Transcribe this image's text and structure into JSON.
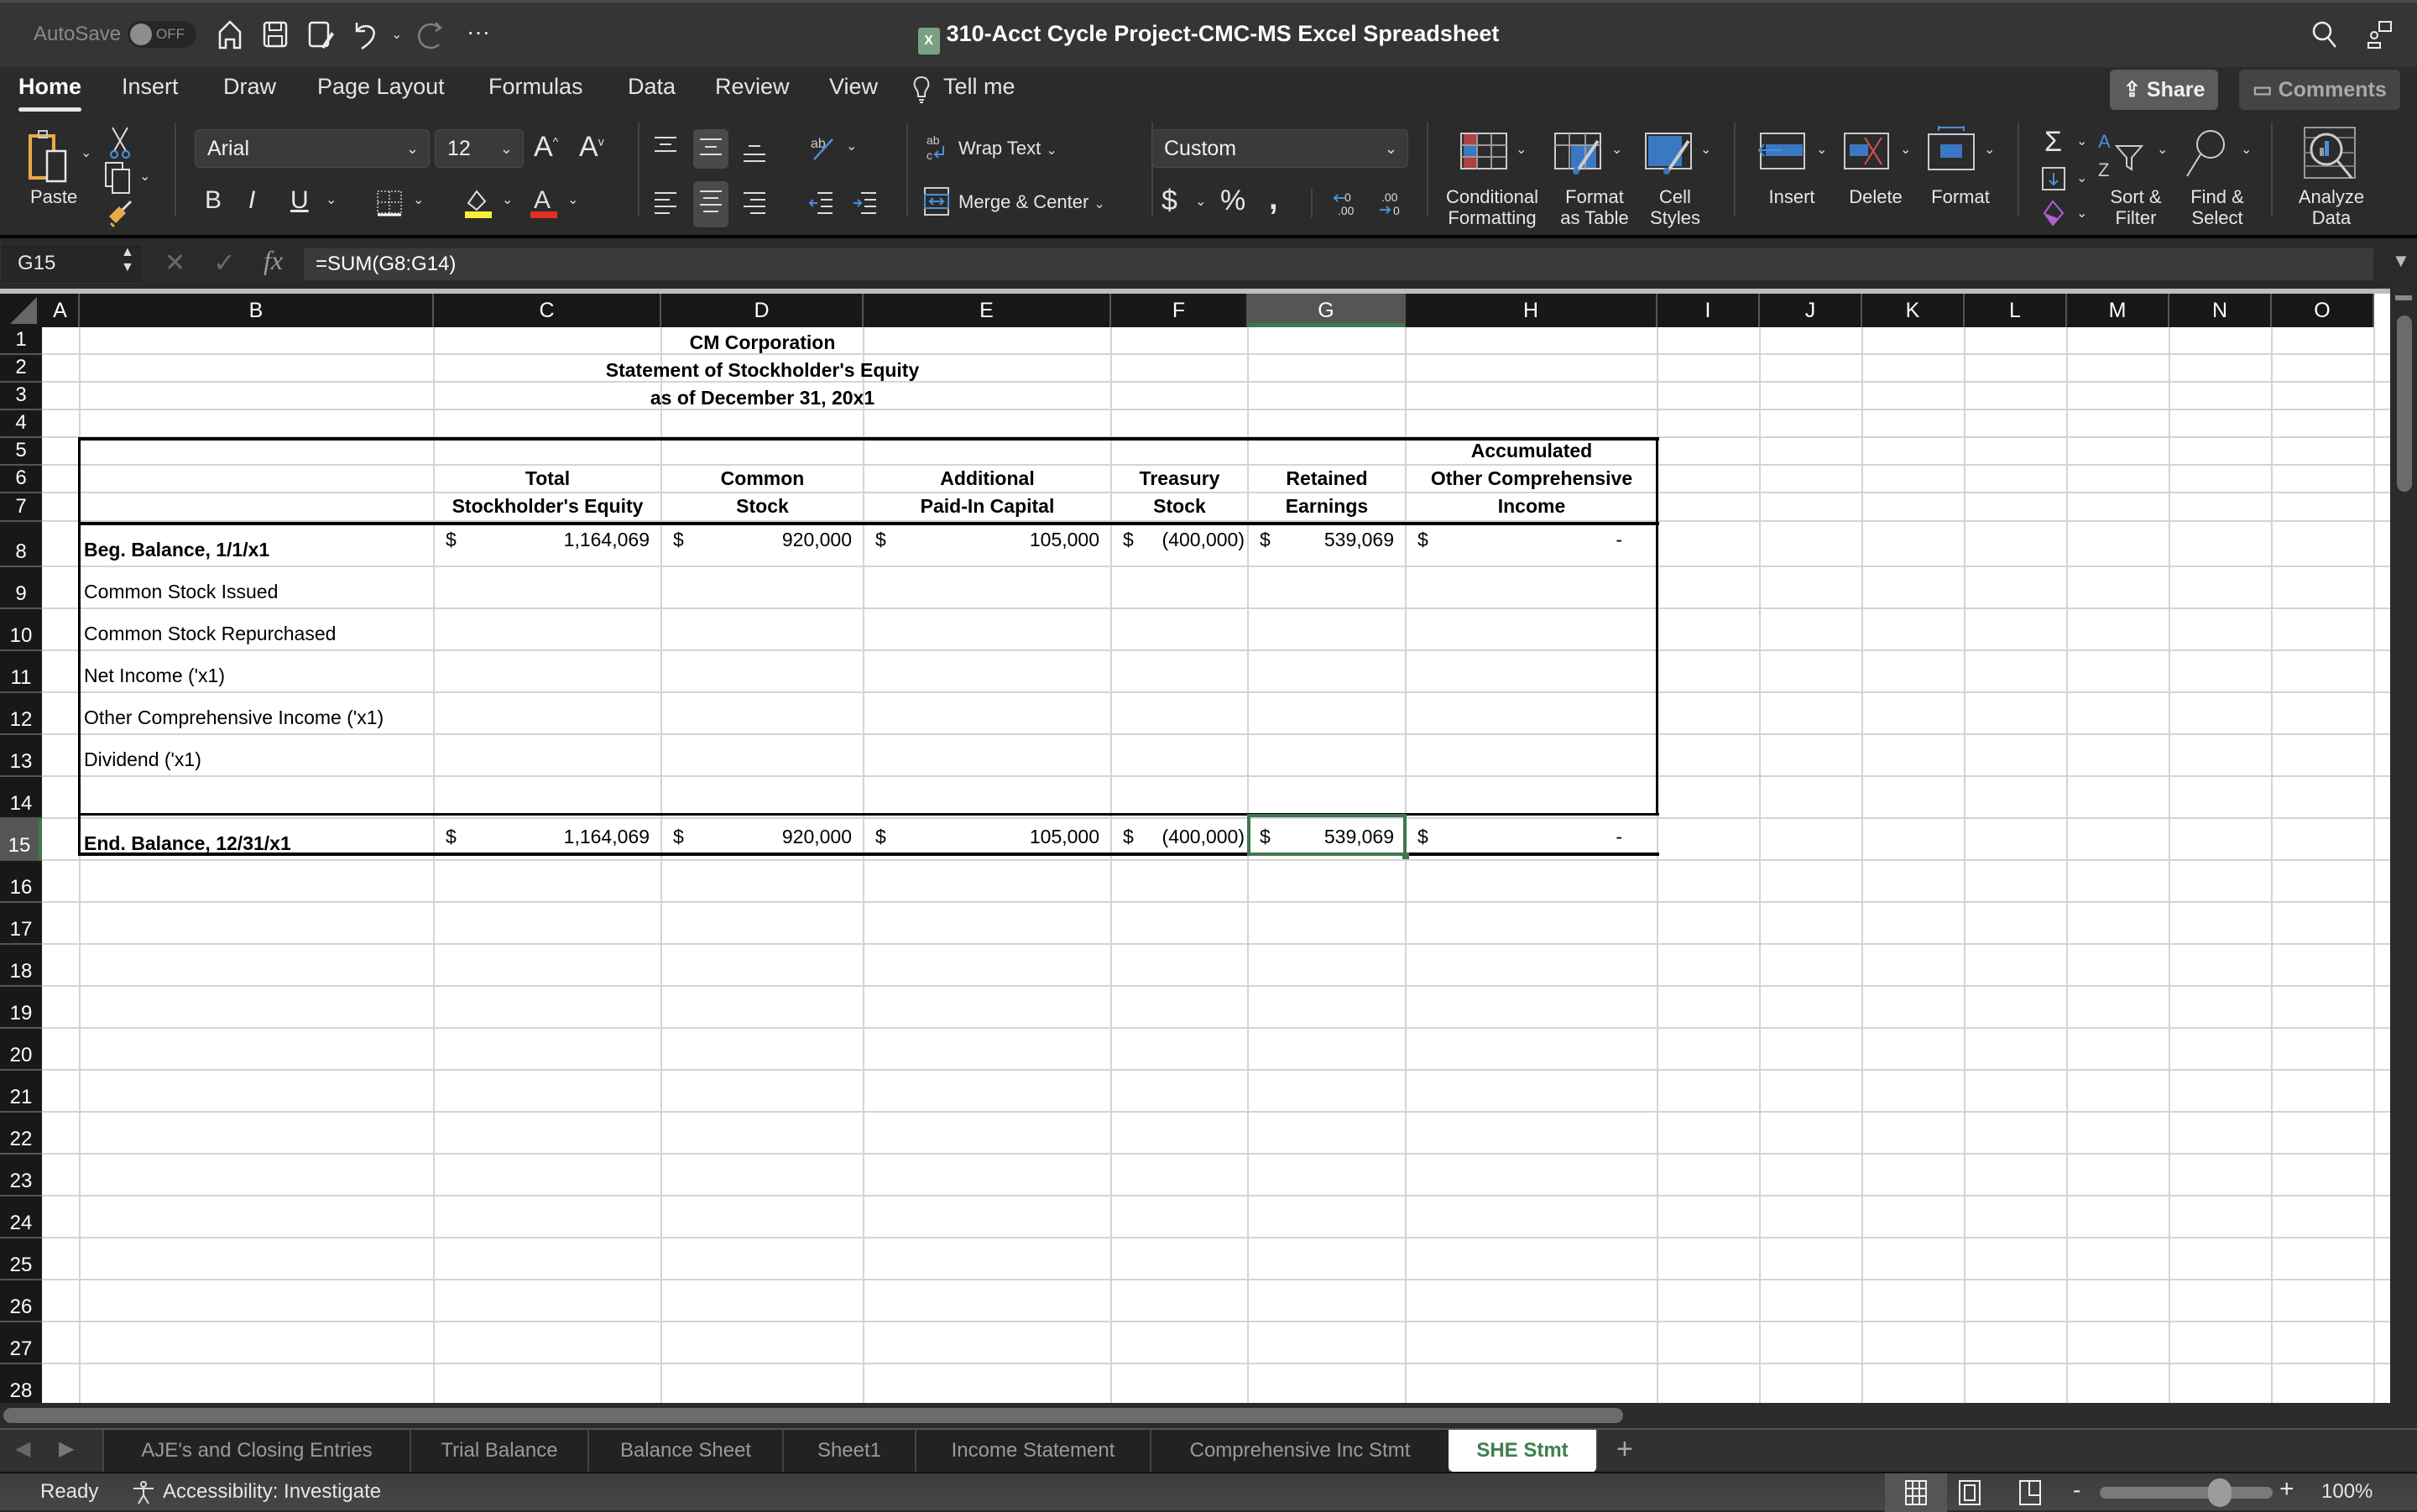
{
  "titlebar": {
    "autosave_label": "AutoSave",
    "autosave_state": "OFF",
    "document_title": "310-Acct Cycle Project-CMC-MS Excel Spreadsheet",
    "icons": [
      "home-icon",
      "save-icon",
      "save-as-icon",
      "undo-icon",
      "redo-icon",
      "more-icon",
      "search-icon",
      "share-people-icon"
    ]
  },
  "ribbon_tabs": [
    {
      "label": "Home",
      "active": true
    },
    {
      "label": "Insert"
    },
    {
      "label": "Draw"
    },
    {
      "label": "Page Layout"
    },
    {
      "label": "Formulas"
    },
    {
      "label": "Data"
    },
    {
      "label": "Review"
    },
    {
      "label": "View"
    },
    {
      "label": "Tell me"
    }
  ],
  "share_label": "Share",
  "comments_label": "Comments",
  "ribbon": {
    "paste_label": "Paste",
    "font_name": "Arial",
    "font_size": "12",
    "wrap_text_label": "Wrap Text",
    "merge_center_label": "Merge & Center",
    "number_format": "Custom",
    "conditional_formatting_label": [
      "Conditional",
      "Formatting"
    ],
    "format_as_table_label": [
      "Format",
      "as Table"
    ],
    "cell_styles_label": [
      "Cell",
      "Styles"
    ],
    "insert_label": "Insert",
    "delete_label": "Delete",
    "format_label": "Format",
    "sort_filter_label": [
      "Sort &",
      "Filter"
    ],
    "find_select_label": [
      "Find &",
      "Select"
    ],
    "analyze_data_label": [
      "Analyze",
      "Data"
    ],
    "fill_color": "#f5f03c",
    "font_color": "#e03127"
  },
  "formula_bar": {
    "name_box": "G15",
    "formula": "=SUM(G8:G14)"
  },
  "columns": [
    "A",
    "B",
    "C",
    "D",
    "E",
    "F",
    "G",
    "H",
    "I",
    "J",
    "K",
    "L",
    "M",
    "N",
    "O"
  ],
  "selected_column": "G",
  "selected_row": "15",
  "rows": [
    "1",
    "2",
    "3",
    "4",
    "5",
    "6",
    "7",
    "8",
    "9",
    "10",
    "11",
    "12",
    "13",
    "14",
    "15",
    "16",
    "17",
    "18",
    "19",
    "20",
    "21",
    "22",
    "23",
    "24",
    "25",
    "26",
    "27",
    "28"
  ],
  "sheet": {
    "title1": "CM Corporation",
    "title2": "Statement of Stockholder's Equity",
    "title3": "as of December 31, 20x1",
    "headers": {
      "C": [
        "Total",
        "Stockholder's Equity"
      ],
      "D": [
        "Common",
        "Stock"
      ],
      "E": [
        "Additional",
        "Paid-In Capital"
      ],
      "F": [
        "Treasury",
        "Stock"
      ],
      "G": [
        "Retained",
        "Earnings"
      ],
      "H": [
        "Accumulated",
        "Other Comprehensive",
        "Income"
      ]
    },
    "line_items": [
      {
        "row": "8",
        "label": "Beg. Balance, 1/1/x1",
        "bold": true,
        "values": {
          "C": "1,164,069",
          "D": "920,000",
          "E": "105,000",
          "F": "(400,000)",
          "G": "539,069",
          "H": "-"
        }
      },
      {
        "row": "9",
        "label": "Common Stock Issued"
      },
      {
        "row": "10",
        "label": "Common Stock Repurchased"
      },
      {
        "row": "11",
        "label": "Net Income ('x1)"
      },
      {
        "row": "12",
        "label": "Other Comprehensive Income ('x1)"
      },
      {
        "row": "13",
        "label": "Dividend ('x1)"
      },
      {
        "row": "14",
        "label": ""
      },
      {
        "row": "15",
        "label": "End. Balance, 12/31/x1",
        "bold": true,
        "values": {
          "C": "1,164,069",
          "D": "920,000",
          "E": "105,000",
          "F": "(400,000)",
          "G": "539,069",
          "H": "-"
        }
      }
    ],
    "currency_symbol": "$"
  },
  "sheet_tabs": [
    {
      "label": "AJE's and Closing Entries"
    },
    {
      "label": "Trial Balance"
    },
    {
      "label": "Balance Sheet"
    },
    {
      "label": "Sheet1"
    },
    {
      "label": "Income Statement"
    },
    {
      "label": "Comprehensive Inc Stmt"
    },
    {
      "label": "SHE Stmt",
      "active": true
    }
  ],
  "status": {
    "ready": "Ready",
    "accessibility": "Accessibility: Investigate",
    "zoom": "100%",
    "zoom_fraction": 0.5
  },
  "colors": {
    "accent_green": "#3e7650",
    "selected_tab_text": "#3e7e50"
  }
}
